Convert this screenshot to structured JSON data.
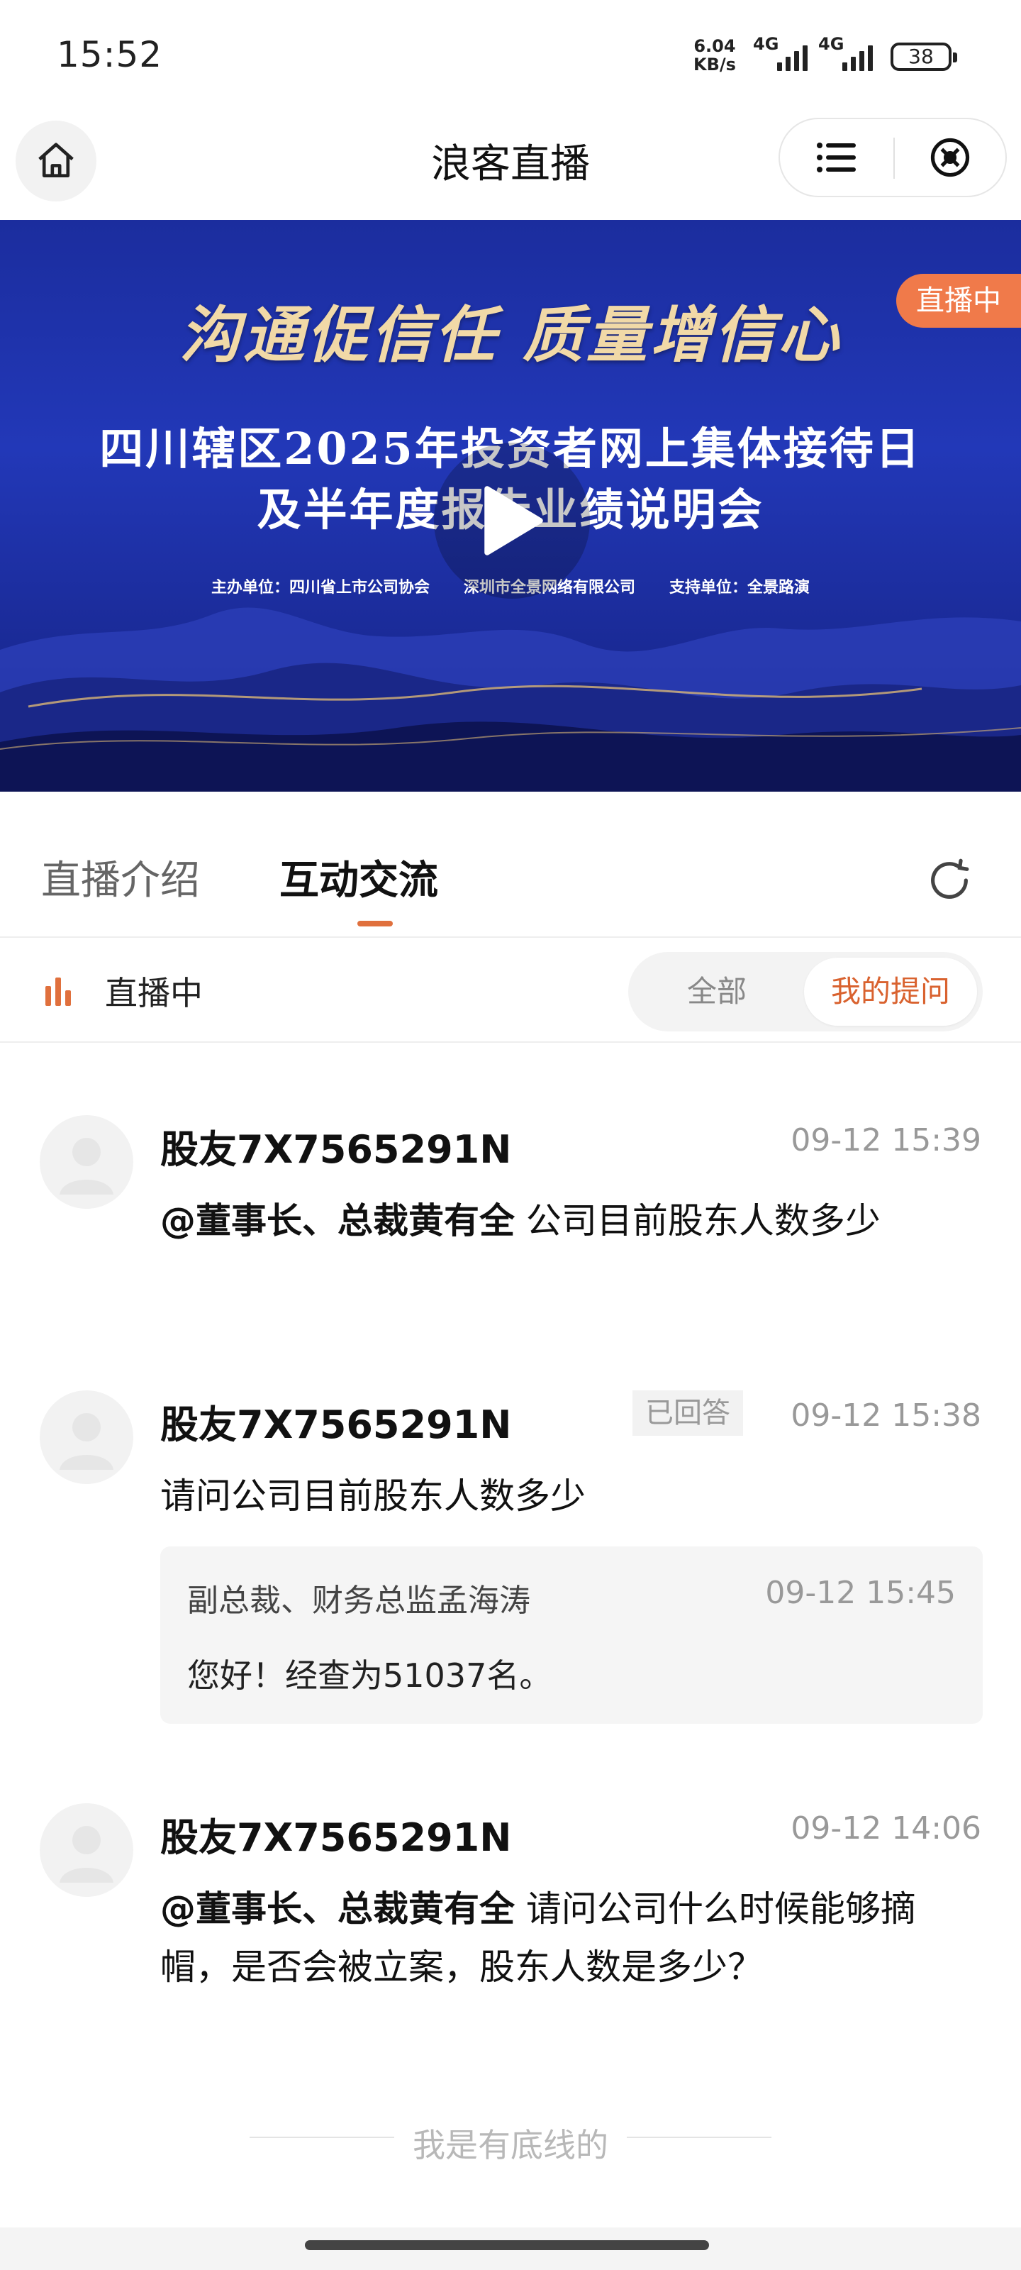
{
  "status_bar": {
    "time": "15:52",
    "speed_value": "6.04",
    "speed_unit": "KB/s",
    "net1": "4G",
    "net2": "4G",
    "battery": "38"
  },
  "nav": {
    "title": "浪客直播",
    "icons": [
      "home-icon",
      "menu-list-icon",
      "close-circle-icon"
    ]
  },
  "banner": {
    "slogan": "沟通促信任 质量增信心",
    "line1": "四川辖区2025年投资者网上集体接待日",
    "line2": "及半年度报告业绩说明会",
    "organizer_label": "主办单位：四川省上市公司协会",
    "organizer2": "深圳市全景网络有限公司",
    "supporter": "支持单位：全景路演",
    "live_tag": "直播中",
    "colors": {
      "background": "#1f33ab",
      "slogan": "#f1d9a7",
      "tag": "#f07a4a"
    }
  },
  "tabs": {
    "intro": "直播介绍",
    "chat": "互动交流",
    "active": "互动交流",
    "accent": "#e0703d"
  },
  "live_row": {
    "label": "直播中",
    "filter_all": "全部",
    "filter_mine": "我的提问",
    "selected": "我的提问"
  },
  "messages": [
    {
      "user": "股友7X7565291N",
      "time": "09-12 15:39",
      "mention": "@董事长、总裁黄有全",
      "text": " 公司目前股东人数多少"
    },
    {
      "user": "股友7X7565291N",
      "badge": "已回答",
      "time": "09-12 15:38",
      "text": "请问公司目前股东人数多少",
      "reply": {
        "author": "副总裁、财务总监孟海涛",
        "time": "09-12 15:45",
        "text": "您好！经查为51037名。"
      }
    },
    {
      "user": "股友7X7565291N",
      "time": "09-12 14:06",
      "mention": "@董事长、总裁黄有全",
      "text": " 请问公司什么时候能够摘帽，是否会被立案，股东人数是多少？"
    }
  ],
  "footer": "我是有底线的"
}
